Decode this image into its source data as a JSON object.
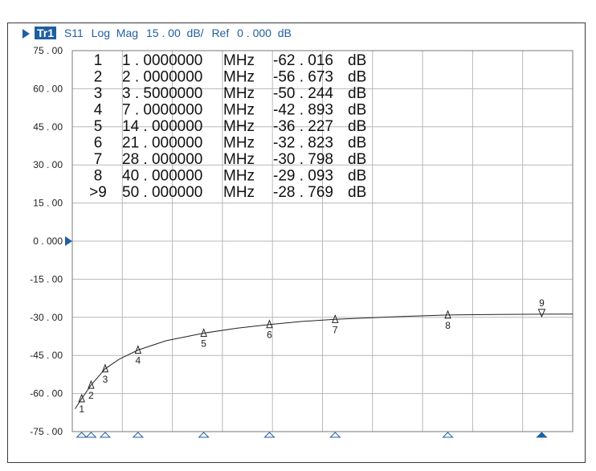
{
  "header": {
    "trace": "Tr1",
    "param": "S11",
    "format": "Log  Mag",
    "scale": "15 . 00  dB/",
    "ref_label": "Ref",
    "ref_value": "0 . 000  dB"
  },
  "colors": {
    "accent": "#1f5fa0",
    "grid": "#b8b8b8",
    "trace": "#222222"
  },
  "marker_table": [
    {
      "id": "1",
      "freq": "1 . 0000000",
      "unit": "MHz",
      "val": "-62 . 016",
      "vunit": "dB"
    },
    {
      "id": "2",
      "freq": "2 . 0000000",
      "unit": "MHz",
      "val": "-56 . 673",
      "vunit": "dB"
    },
    {
      "id": "3",
      "freq": "3 . 5000000",
      "unit": "MHz",
      "val": "-50 . 244",
      "vunit": "dB"
    },
    {
      "id": "4",
      "freq": "7 . 0000000",
      "unit": "MHz",
      "val": "-42 . 893",
      "vunit": "dB"
    },
    {
      "id": "5",
      "freq": "14 . 000000",
      "unit": "MHz",
      "val": "-36 . 227",
      "vunit": "dB"
    },
    {
      "id": "6",
      "freq": "21 . 000000",
      "unit": "MHz",
      "val": "-32 . 823",
      "vunit": "dB"
    },
    {
      "id": "7",
      "freq": "28 . 000000",
      "unit": "MHz",
      "val": "-30 . 798",
      "vunit": "dB"
    },
    {
      "id": "8",
      "freq": "40 . 000000",
      "unit": "MHz",
      "val": "-29 . 093",
      "vunit": "dB"
    },
    {
      "id": ">9",
      "freq": "50 . 000000",
      "unit": "MHz",
      "val": "-28 . 769",
      "vunit": "dB"
    }
  ],
  "chart_data": {
    "type": "line",
    "title": "",
    "xlabel": "",
    "ylabel": "",
    "ylim": [
      -75,
      75
    ],
    "xlim": [
      0,
      53.3
    ],
    "y_ticks": [
      "75 . 00",
      "60 . 00",
      "45 . 00",
      "30 . 00",
      "15 . 00",
      "0 . 000",
      "-15 . 00",
      "-30 . 00",
      "-45 . 00",
      "-60 . 00",
      "-75 . 00"
    ],
    "y_tick_values": [
      75,
      60,
      45,
      30,
      15,
      0,
      -15,
      -30,
      -45,
      -60,
      -75
    ],
    "grid": true,
    "x_divisions": 10,
    "reference_level": 0,
    "series": [
      {
        "x": [
          0.3,
          1,
          2,
          3.5,
          5,
          7,
          10,
          14,
          17.5,
          21,
          24.5,
          28,
          34,
          40,
          45,
          50,
          53.3
        ],
        "values": [
          -66,
          -62.016,
          -56.673,
          -50.244,
          -46.5,
          -42.893,
          -39.2,
          -36.227,
          -34.3,
          -32.823,
          -31.6,
          -30.798,
          -29.8,
          -29.093,
          -28.9,
          -28.769,
          -28.7
        ]
      }
    ],
    "markers": [
      {
        "label": "1",
        "x": 1,
        "y": -62.016
      },
      {
        "label": "2",
        "x": 2,
        "y": -56.673
      },
      {
        "label": "3",
        "x": 3.5,
        "y": -50.244
      },
      {
        "label": "4",
        "x": 7,
        "y": -42.893
      },
      {
        "label": "5",
        "x": 14,
        "y": -36.227
      },
      {
        "label": "6",
        "x": 21,
        "y": -32.823
      },
      {
        "label": "7",
        "x": 28,
        "y": -30.798
      },
      {
        "label": "8",
        "x": 40,
        "y": -29.093
      },
      {
        "label": "9",
        "x": 50,
        "y": -28.769,
        "active": true
      }
    ]
  }
}
